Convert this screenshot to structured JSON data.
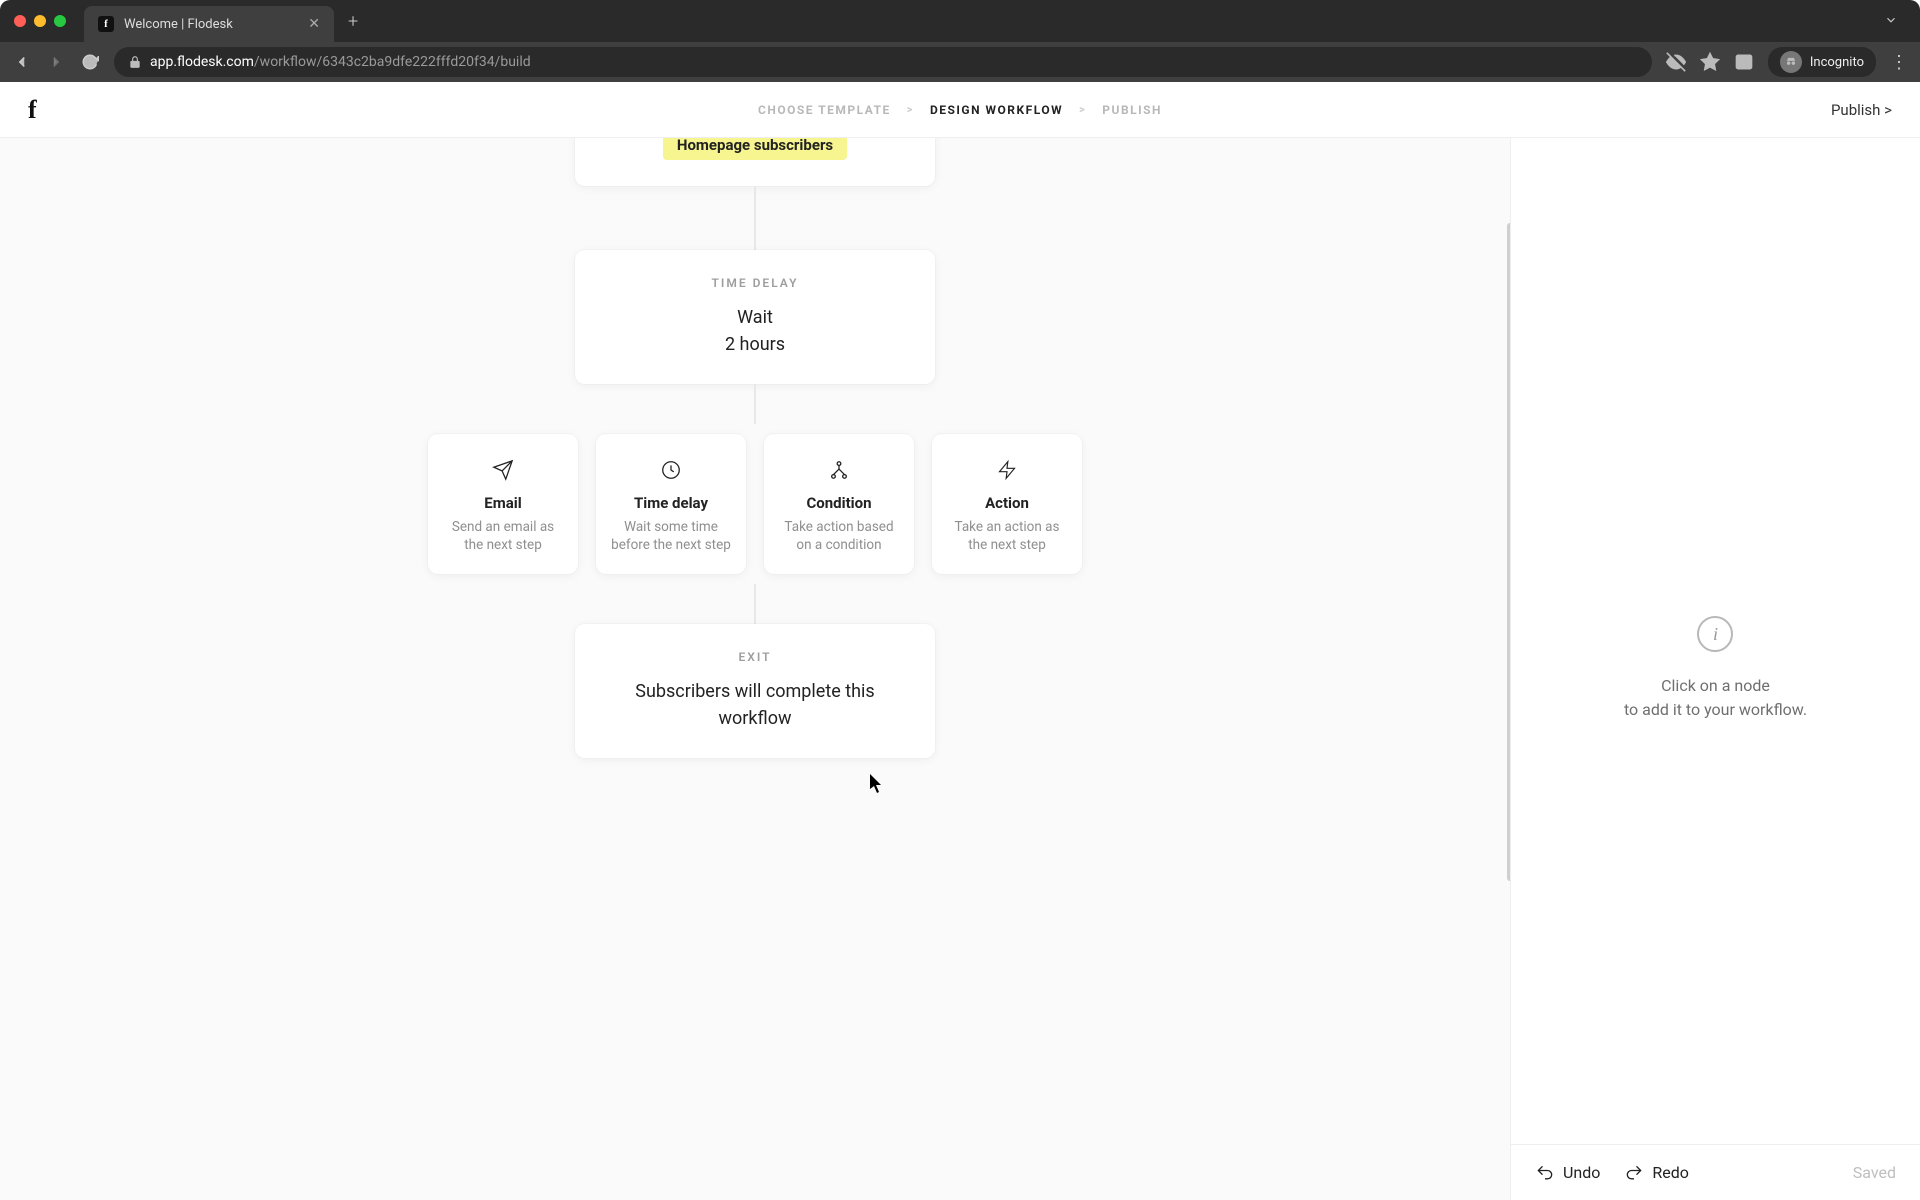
{
  "browser": {
    "tab_title": "Welcome | Flodesk",
    "url_domain": "app.flodesk.com",
    "url_path": "/workflow/6343c2ba9dfe222fffd20f34/build",
    "incognito_label": "Incognito"
  },
  "header": {
    "steps": {
      "step1": "CHOOSE TEMPLATE",
      "step2": "DESIGN WORKFLOW",
      "step3": "PUBLISH"
    },
    "publish_link": "Publish >"
  },
  "workflow": {
    "segment_label": "Homepage subscribers",
    "time_delay": {
      "label": "TIME DELAY",
      "line1": "Wait",
      "line2": "2 hours"
    },
    "picker": {
      "email": {
        "title": "Email",
        "desc": "Send an email as the next step"
      },
      "time_delay": {
        "title": "Time delay",
        "desc": "Wait some time before the next step"
      },
      "condition": {
        "title": "Condition",
        "desc": "Take action based on a condition"
      },
      "action": {
        "title": "Action",
        "desc": "Take an action as the next step"
      }
    },
    "exit": {
      "label": "EXIT",
      "text": "Subscribers will complete this workflow"
    }
  },
  "sidebar": {
    "hint_line1": "Click on a node",
    "hint_line2": "to add it to your workflow."
  },
  "footer": {
    "undo": "Undo",
    "redo": "Redo",
    "saved": "Saved"
  }
}
